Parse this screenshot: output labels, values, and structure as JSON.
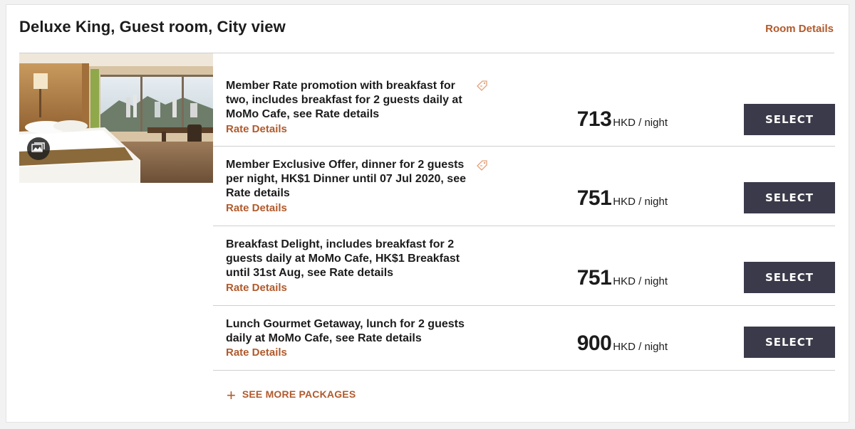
{
  "room": {
    "title": "Deluxe King, Guest room, City view",
    "details_link": "Room Details",
    "gallery_icon": "gallery-icon"
  },
  "rates": [
    {
      "description": "Member Rate promotion with breakfast for two, includes breakfast for 2 guests daily at MoMo Cafe, see Rate details",
      "details_link": "Rate Details",
      "has_tag": true,
      "price": "713",
      "unit": "HKD / night",
      "select_label": "SELECT"
    },
    {
      "description": "Member Exclusive Offer, dinner for 2 guests per night, HK$1 Dinner until 07 Jul 2020, see Rate details",
      "details_link": "Rate Details",
      "has_tag": true,
      "price": "751",
      "unit": "HKD / night",
      "select_label": "SELECT"
    },
    {
      "description": "Breakfast Delight, includes breakfast for 2 guests daily at MoMo Cafe, HK$1 Breakfast until 31st Aug, see Rate details",
      "details_link": "Rate Details",
      "has_tag": false,
      "price": "751",
      "unit": "HKD / night",
      "select_label": "SELECT"
    },
    {
      "description": "Lunch Gourmet Getaway, lunch for 2 guests daily at MoMo Cafe, see Rate details",
      "details_link": "Rate Details",
      "has_tag": false,
      "price": "900",
      "unit": "HKD / night",
      "select_label": "SELECT"
    }
  ],
  "see_more": {
    "icon": "plus",
    "label": "SEE MORE PACKAGES"
  },
  "colors": {
    "accent": "#b15a2c",
    "button": "#3b3a4a",
    "text": "#1c1c1c",
    "divider": "#cfcfcf"
  }
}
